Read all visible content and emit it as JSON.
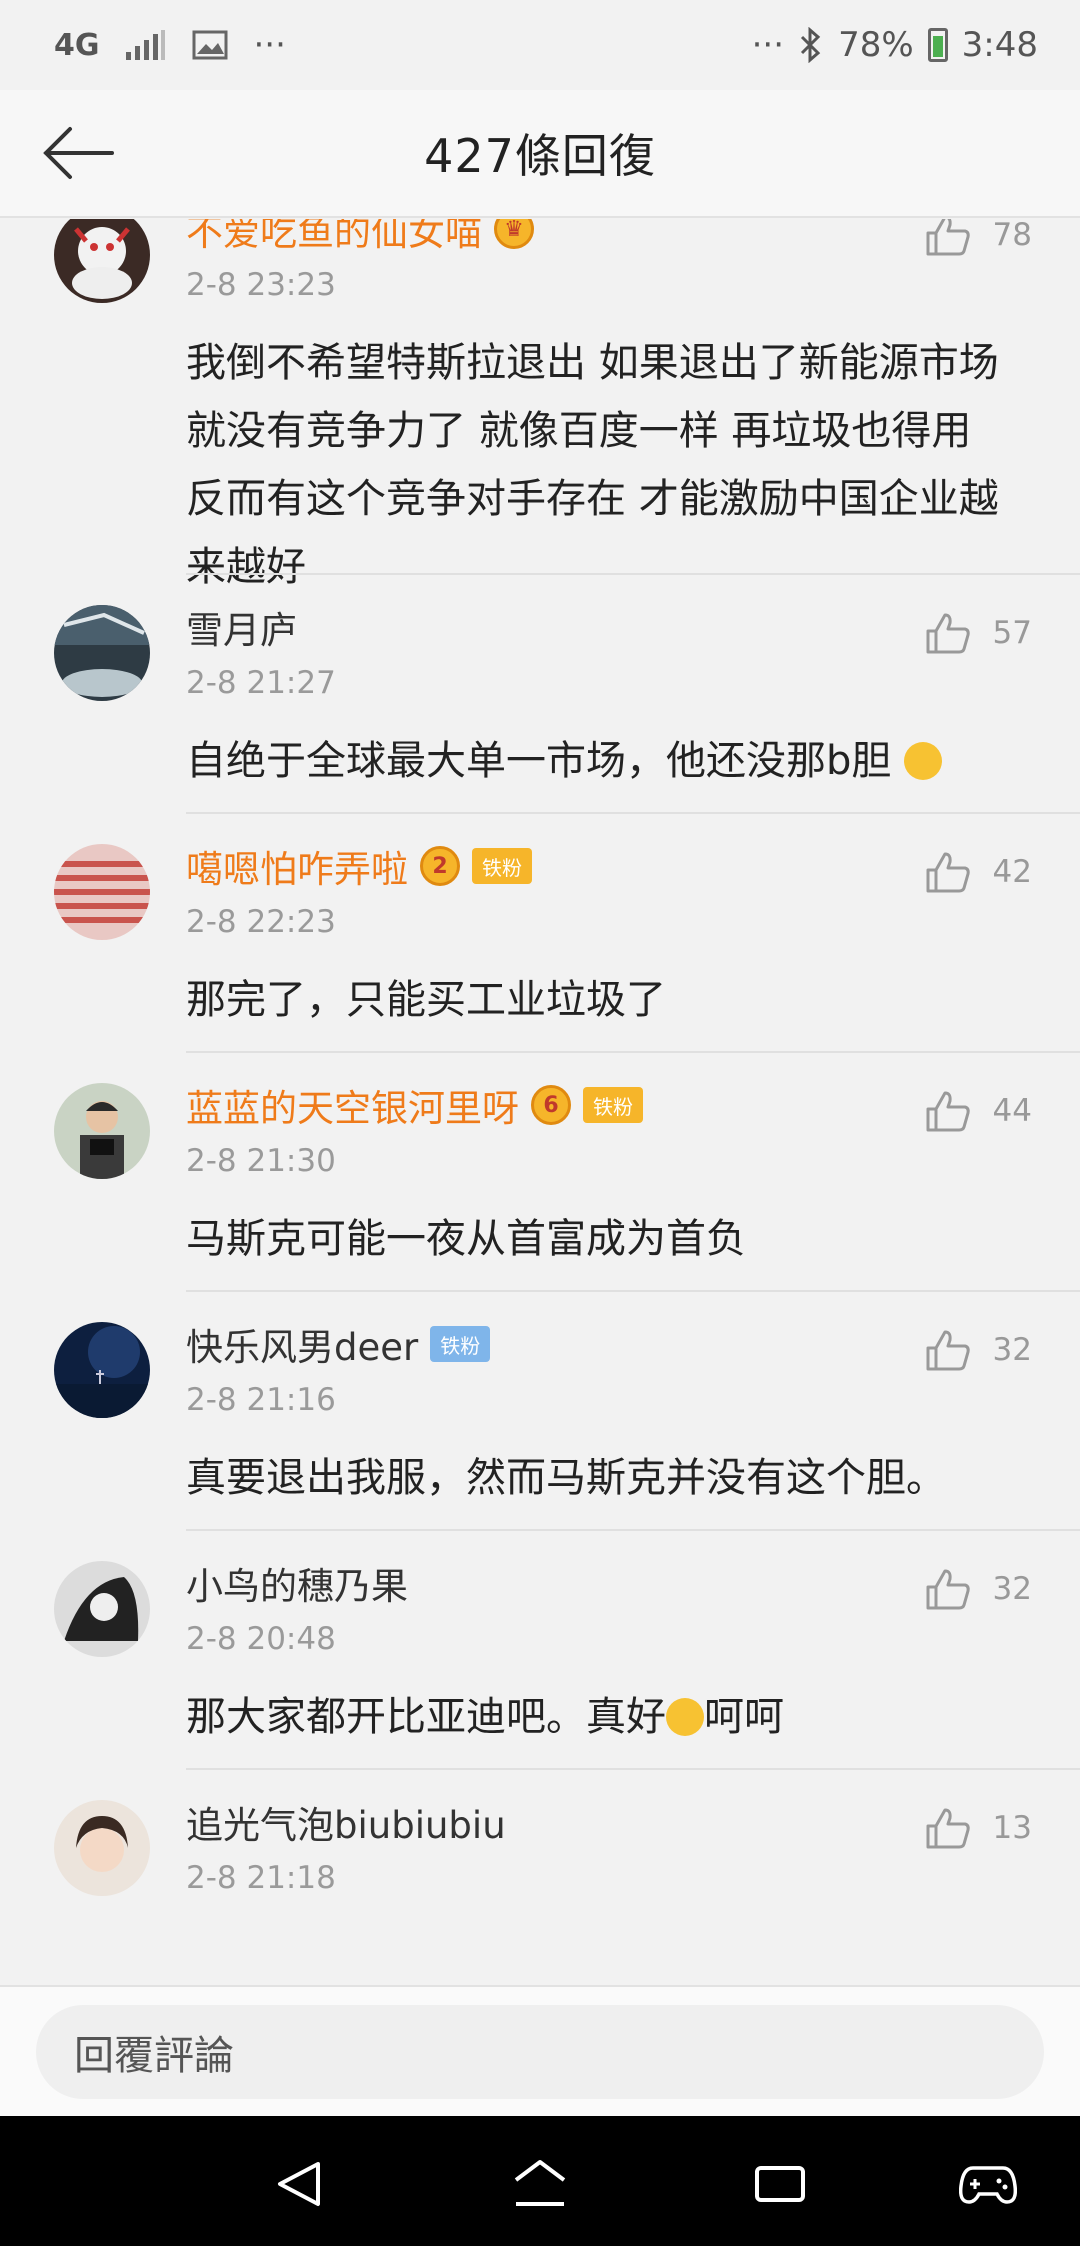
{
  "status_bar": {
    "network": "4G",
    "left_ellipsis": "···",
    "right_ellipsis": "···",
    "battery": "78%",
    "time": "3:48"
  },
  "header": {
    "title": "427條回復"
  },
  "comments": [
    {
      "username": "不爱吃鱼的仙女喵",
      "time": "2-8 23:23",
      "likes": "78",
      "content": "我倒不希望特斯拉退出 如果退出了新能源市场就没有竞争力了 就像百度一样 再垃圾也得用 反而有这个竞争对手存在 才能激励中国企业越来越好"
    },
    {
      "username": "雪月庐",
      "time": "2-8 21:27",
      "likes": "57",
      "content": "自绝于全球最大单一市场，他还没那b胆"
    },
    {
      "username": "噶嗯怕咋弄啦",
      "time": "2-8 22:23",
      "likes": "42",
      "fan_badge": "铁粉",
      "crown_level": "2",
      "content": "那完了，只能买工业垃圾了"
    },
    {
      "username": "蓝蓝的天空银河里呀",
      "time": "2-8 21:30",
      "likes": "44",
      "fan_badge": "铁粉",
      "crown_level": "6",
      "content": "马斯克可能一夜从首富成为首负"
    },
    {
      "username": "快乐风男deer",
      "time": "2-8 21:16",
      "likes": "32",
      "fan_badge": "铁粉",
      "content": "真要退出我服，然而马斯克并没有这个胆。"
    },
    {
      "username": "小鸟的穗乃果",
      "time": "2-8 20:48",
      "likes": "32",
      "content_a": "那大家都开比亚迪吧。真好",
      "content_b": "呵呵"
    },
    {
      "username": "追光气泡biubiubiu",
      "time": "2-8 21:18",
      "likes": "13",
      "content": ""
    }
  ],
  "reply_bar": {
    "placeholder": "回覆評論"
  },
  "colors": {
    "vip_name": "#ef7b1a",
    "accent_badge": "#f6b52a",
    "blue_badge": "#7fb5ea"
  }
}
